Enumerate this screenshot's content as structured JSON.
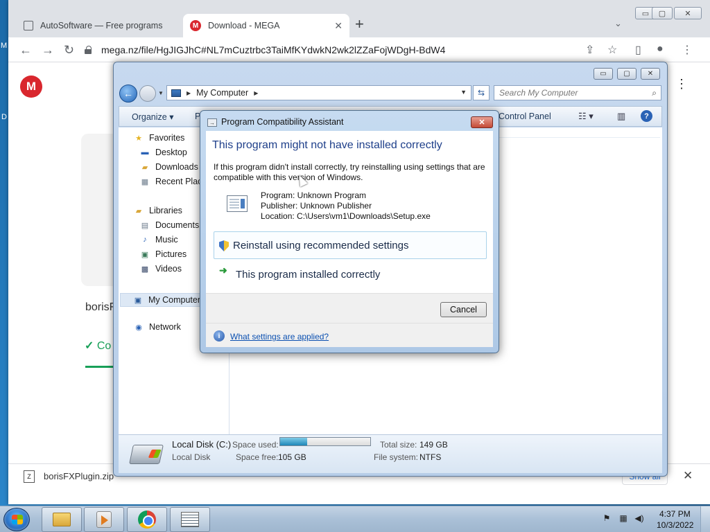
{
  "browser": {
    "tabs": [
      {
        "title": "AutoSoftware — Free programs"
      },
      {
        "title": "Download - MEGA"
      }
    ],
    "url": "mega.nz/file/HgJIGJhC#NL7mCuztrbc3TaiMfKYdwkN2wk2lZZaFojWDgH-BdW4",
    "page": {
      "file_title_partial": "borisF",
      "status_partial": "Co"
    },
    "download_shelf": {
      "file_name": "borisFXPlugin.zip",
      "show_all": "Show all"
    }
  },
  "explorer": {
    "address": "My Computer",
    "search_placeholder": "Search My Computer",
    "commands": {
      "organize": "Organize",
      "properties_partial": "P",
      "control_panel": "Control Panel"
    },
    "nav": {
      "favorites": "Favorites",
      "desktop": "Desktop",
      "downloads": "Downloads",
      "recent_places": "Recent Places",
      "libraries": "Libraries",
      "documents": "Documents",
      "music": "Music",
      "pictures": "Pictures",
      "videos": "Videos",
      "my_computer": "My Computer",
      "network": "Network"
    },
    "details": {
      "name": "Local Disk (C:)",
      "type": "Local Disk",
      "space_used_label": "Space used:",
      "space_used_fraction": 0.3,
      "space_free_label": "Space free:",
      "space_free_value": "105 GB",
      "total_size_label": "Total size:",
      "total_size_value": "149 GB",
      "file_system_label": "File system:",
      "file_system_value": "NTFS"
    }
  },
  "dialog": {
    "title": "Program Compatibility Assistant",
    "heading": "This program might not have installed correctly",
    "description": "If this program didn't install correctly, try reinstalling using settings that are compatible with this version of Windows.",
    "program": "Program: Unknown Program",
    "publisher": "Publisher: Unknown Publisher",
    "location": "Location: C:\\Users\\vm1\\Downloads\\Setup.exe",
    "option_reinstall": "Reinstall using recommended settings",
    "option_ok": "This program installed correctly",
    "cancel": "Cancel",
    "help_link": "What settings are applied?"
  },
  "taskbar": {
    "time": "4:37 PM",
    "date": "10/3/2022"
  }
}
